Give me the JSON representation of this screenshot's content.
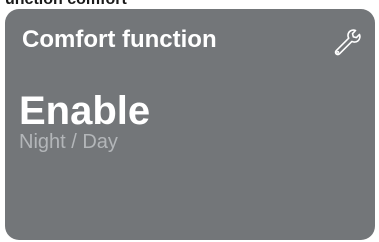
{
  "header": {
    "caption": "unction comfort"
  },
  "tile": {
    "title": "Comfort function",
    "value": "Enable",
    "sub_label": "Night / Day",
    "settings_icon": "wrench-icon",
    "colors": {
      "background": "#737679",
      "text": "#ffffff",
      "muted_text": "#b3b6b9"
    }
  }
}
